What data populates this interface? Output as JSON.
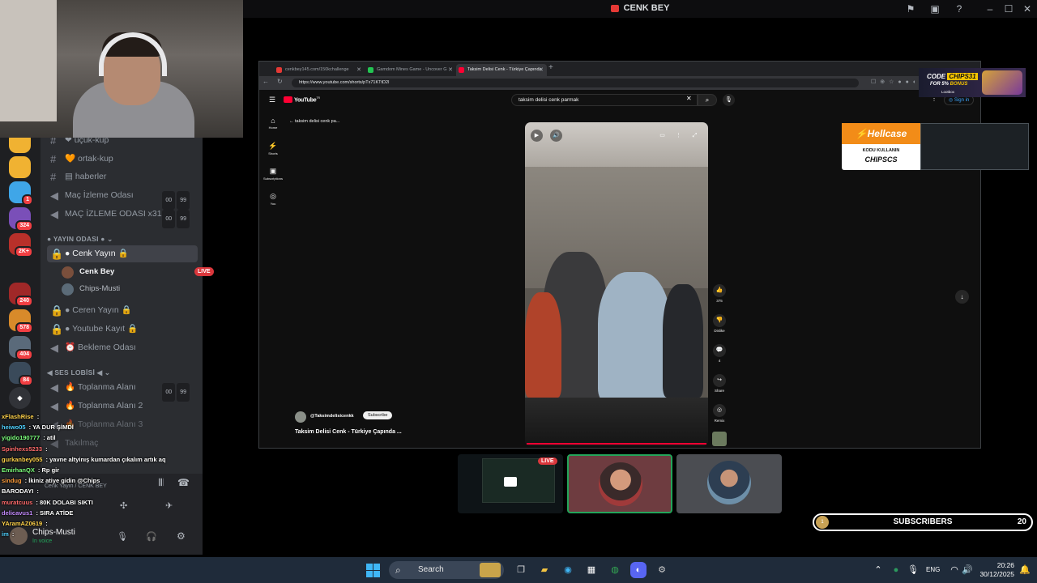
{
  "app": {
    "title": "CENK BEY"
  },
  "window_controls": {
    "minimize": "–",
    "maximize": "☐",
    "close": "✕"
  },
  "channels": {
    "top": [
      {
        "icon": "❤",
        "name": "uçuk-kup"
      },
      {
        "icon": "🧡",
        "name": "ortak-kup"
      },
      {
        "icon": "▤",
        "name": "haberler"
      }
    ],
    "voice_top": [
      {
        "name": "Maç İzleme Odası",
        "a": "00",
        "b": "99"
      },
      {
        "name": "MAÇ İZLEME ODASI x31",
        "a": "00",
        "b": "99"
      }
    ],
    "cat_yayin": "YAYIN ODASI",
    "active_channel": "Cenk Yayın",
    "users": [
      {
        "name": "Cenk Bey",
        "live": "LIVE"
      },
      {
        "name": "Chips-Musti"
      }
    ],
    "yayin_others": [
      "Ceren Yayın",
      "Youtube Kayıt",
      "Bekleme Odası"
    ],
    "cat_ses": "SES LOBİSİ",
    "ses": [
      {
        "name": "Toplanma Alanı",
        "a": "00",
        "b": "99"
      },
      {
        "name": "Toplanma Alanı 2"
      },
      {
        "name": "Toplanma Alanı 3"
      },
      {
        "name": "Takılmaç"
      }
    ]
  },
  "servers": [
    {
      "label": "",
      "badge": ""
    },
    {
      "label": "",
      "badge": ""
    },
    {
      "label": "",
      "badge": "1"
    },
    {
      "label": "",
      "badge": "324"
    },
    {
      "label": "",
      "badge": "2K+"
    },
    {
      "label": "",
      "badge": "240"
    },
    {
      "label": "",
      "badge": "578"
    },
    {
      "label": "",
      "badge": "404"
    },
    {
      "label": "",
      "badge": "84"
    }
  ],
  "voice_panel": {
    "location": "Cenk Yayın / CENK BEY",
    "user": "Chips-Musti",
    "status": "In voice"
  },
  "chat": [
    {
      "name": "xFlashRise",
      "text": ":",
      "color": "#ffd24a"
    },
    {
      "name": "heiwo05",
      "text": ": YA DUR ŞİMDİ",
      "color": "#4fd1ff"
    },
    {
      "name": "yigido190777",
      "text": ": atil",
      "color": "#7cff7c"
    },
    {
      "name": "Spinhexs5233",
      "text": ":",
      "color": "#ff6b6b"
    },
    {
      "name": "gurkanbey055",
      "text": ": yavne altyinış kumardan çıkalım artık aq",
      "color": "#ffd24a"
    },
    {
      "name": "EmirhanQX",
      "text": ": Rp gir",
      "color": "#7cff7c"
    },
    {
      "name": "sindug",
      "text": ": İkiniz atiye gidin @Chips",
      "color": "#ff9d3c"
    },
    {
      "name": "BARODAYI",
      "text": ":",
      "color": "#ffffff"
    },
    {
      "name": "muratcuus",
      "text": ": 80K DOLABI SIKTI",
      "color": "#ff6b6b"
    },
    {
      "name": "delicavus1",
      "text": ": SIRA ATİDE",
      "color": "#c58cff"
    },
    {
      "name": "YAramAZ0619",
      "text": ":",
      "color": "#ffd24a"
    },
    {
      "name": "im",
      "text": ":",
      "color": "#4fd1ff"
    }
  ],
  "browser": {
    "tabs": [
      {
        "title": "cenkbey145.com/150kchallenge",
        "color": "#e53935"
      },
      {
        "title": "Gamdom Mines Game - Uncover G",
        "color": "#23c552"
      },
      {
        "title": "Taksim Delisi Cenk - Türkiye Çapında",
        "color": "#ff0033"
      }
    ],
    "new_tab": "+",
    "url": "https://www.youtube.com/shorts/pTx71KTtD2I"
  },
  "youtube": {
    "logo": "YouTube",
    "logo_sup": "TR",
    "search": "taksim delisi cenk parmak",
    "sign_in": "Sign in",
    "sidebar": [
      "Home",
      "Shorts",
      "Subscriptions",
      "You"
    ],
    "back_text": "taksim delisi cenk pa...",
    "channel": "@Taksimdelisicenkk",
    "subscribe": "Subscribe",
    "title": "Taksim Delisi Cenk - Türkiye Çapında ...",
    "actions": [
      {
        "label": "375",
        "icon": "👍"
      },
      {
        "label": "Dislike",
        "icon": "👎"
      },
      {
        "label": "4",
        "icon": "💬"
      },
      {
        "label": "Share",
        "icon": "↪"
      },
      {
        "label": "Remix",
        "icon": "◎"
      }
    ]
  },
  "ads": {
    "code_line": "CODE",
    "code": "CHIPS31",
    "bonus_pre": "FOR 5% ",
    "bonus": "BONUS",
    "brand_small": "Lootbox",
    "hellcase": "Hellcase",
    "kodu": "KODU KULLANIN",
    "hell_code": "CHIPSCS"
  },
  "participants": {
    "live": "LIVE"
  },
  "subscribers": {
    "label": "SUBSCRIBERS",
    "count": "20",
    "goal_marker": "1"
  },
  "taskbar": {
    "search": "Search",
    "lang": "ENG",
    "time": "20:26",
    "date": "30/12/2025"
  }
}
